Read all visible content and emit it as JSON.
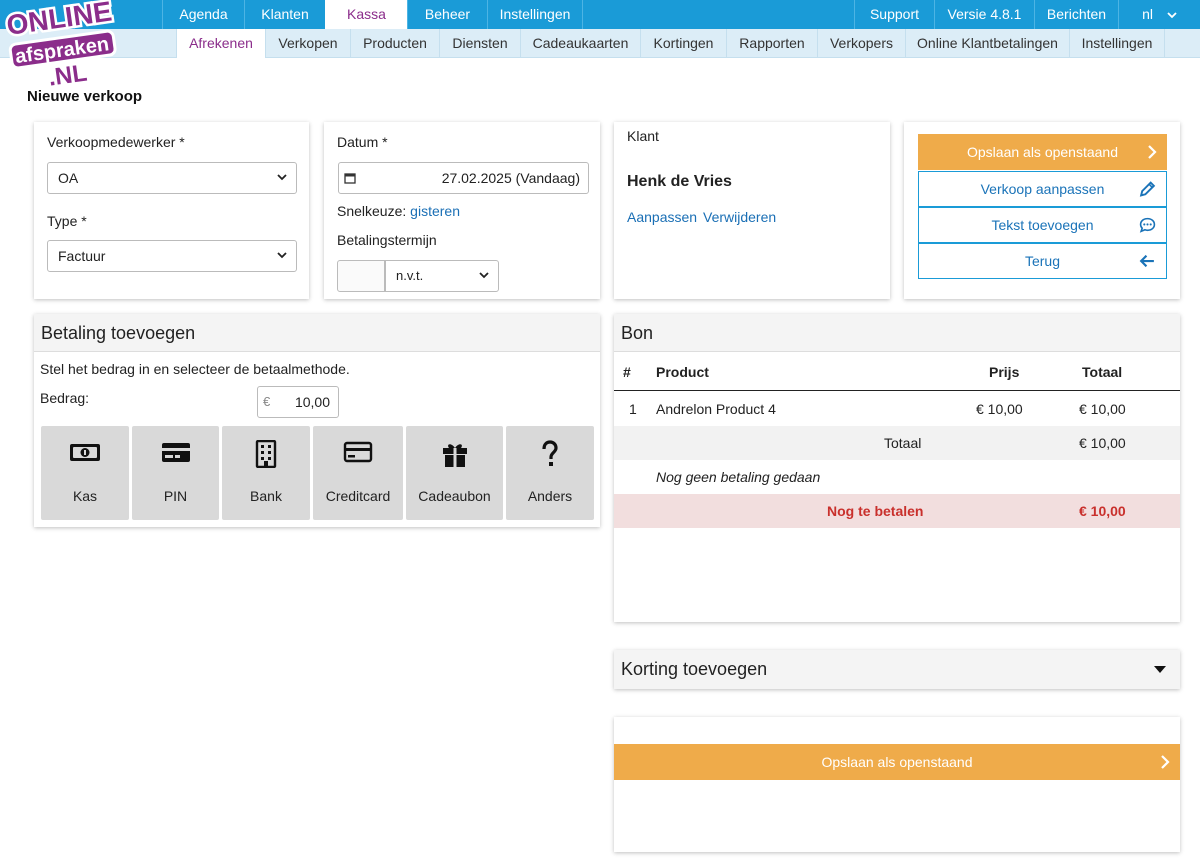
{
  "top_nav": {
    "left": [
      "Agenda",
      "Klanten",
      "Kassa",
      "Beheer",
      "Instellingen"
    ],
    "right": [
      "Support",
      "Versie 4.8.1",
      "Berichten",
      "nl"
    ]
  },
  "sub_nav": [
    "Afrekenen",
    "Verkopen",
    "Producten",
    "Diensten",
    "Cadeaukaarten",
    "Kortingen",
    "Rapporten",
    "Verkopers",
    "Online Klantbetalingen",
    "Instellingen"
  ],
  "logo": {
    "line1": "ONLINE",
    "line2": "afspraken",
    "line3": ".NL"
  },
  "page_title": "Nieuwe verkoop",
  "employee": {
    "label": "Verkoopmedewerker *",
    "value": "OA"
  },
  "type": {
    "label": "Type *",
    "value": "Factuur"
  },
  "date": {
    "label": "Datum *",
    "value": "27.02.2025 (Vandaag)",
    "quick_label": "Snelkeuze:",
    "quick_link": "gisteren",
    "term_label": "Betalingstermijn",
    "term_value": "n.v.t."
  },
  "customer": {
    "label": "Klant",
    "name": "Henk de Vries",
    "edit": "Aanpassen",
    "remove": "Verwijderen"
  },
  "actions": {
    "save_open": "Opslaan als openstaand",
    "edit_sale": "Verkoop aanpassen",
    "add_text": "Tekst toevoegen",
    "back": "Terug"
  },
  "payment": {
    "title": "Betaling toevoegen",
    "instruction": "Stel het bedrag in en selecteer de betaalmethode.",
    "amount_label": "Bedrag:",
    "currency": "€",
    "amount": "10,00",
    "methods": [
      {
        "label": "Kas",
        "icon": "cash-icon"
      },
      {
        "label": "PIN",
        "icon": "card-icon"
      },
      {
        "label": "Bank",
        "icon": "building-icon"
      },
      {
        "label": "Creditcard",
        "icon": "credit-card-icon"
      },
      {
        "label": "Cadeaubon",
        "icon": "gift-icon"
      },
      {
        "label": "Anders",
        "icon": "question-icon"
      }
    ]
  },
  "receipt": {
    "title": "Bon",
    "columns": [
      "#",
      "Product",
      "Prijs",
      "Totaal"
    ],
    "items": [
      {
        "num": "1",
        "product": "Andrelon Product 4",
        "price": "€ 10,00",
        "total": "€ 10,00"
      }
    ],
    "total_label": "Totaal",
    "total_value": "€ 10,00",
    "no_payment": "Nog geen betaling gedaan",
    "due_label": "Nog te betalen",
    "due_value": "€ 10,00"
  },
  "discount": {
    "title": "Korting toevoegen"
  },
  "colors": {
    "nav": "#1a9bd7",
    "accent": "#efab4a",
    "active": "#8b2d8b",
    "due_bg": "#f2dede",
    "due_text": "#c9302c"
  }
}
